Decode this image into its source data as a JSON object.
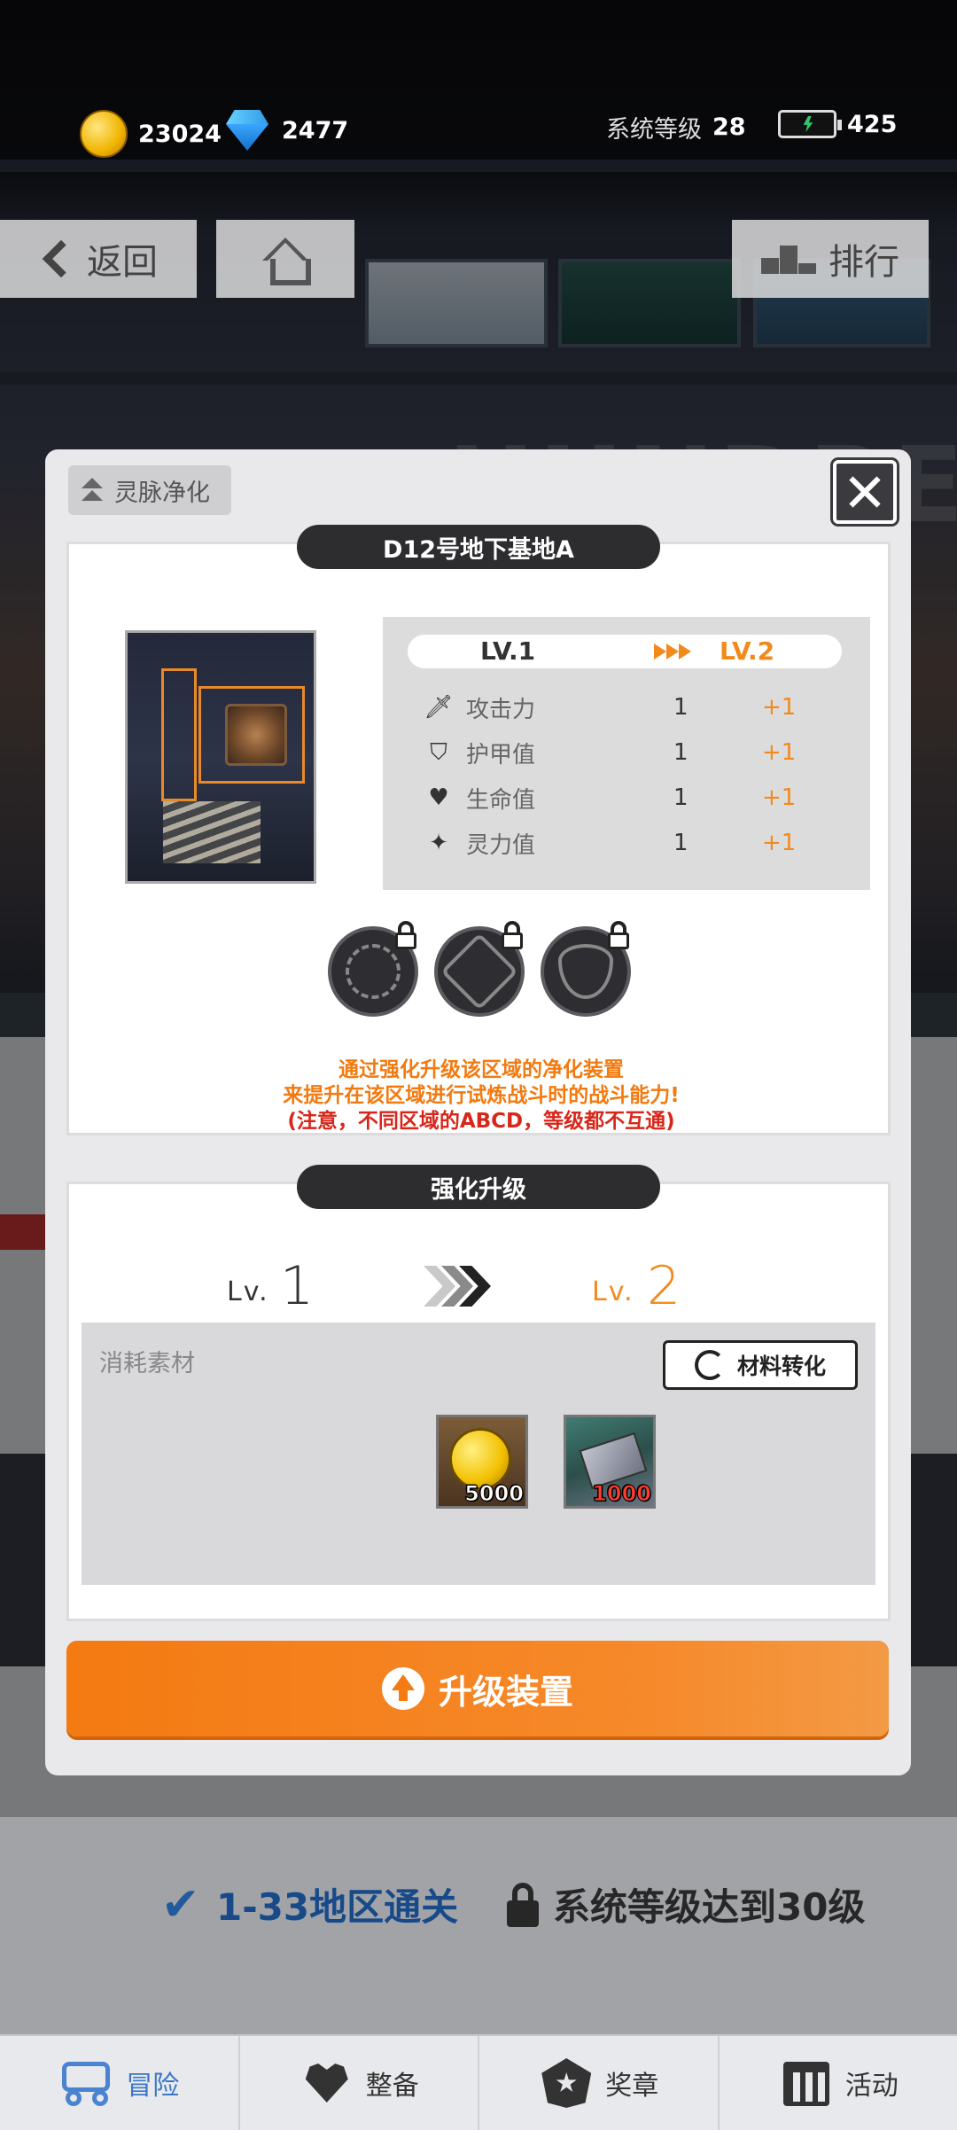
{
  "topbar": {
    "coins": "23024",
    "gems": "2477",
    "system_level_label": "系统等级",
    "system_level": "28",
    "energy": "425",
    "icons": {
      "coins": "gold-coin-icon",
      "gems": "diamond-icon",
      "energy": "battery-icon"
    }
  },
  "nav_buttons": {
    "back": "返回",
    "home": "home-icon",
    "rank": "排行"
  },
  "scene": {
    "watermark": "HUNDRED"
  },
  "modal": {
    "tag": "灵脉净化",
    "area_title": "D12号地下基地A",
    "level_from": "LV.1",
    "level_to": "LV.2",
    "stats": [
      {
        "icon": "attack-icon",
        "name": "攻击力",
        "value": "1",
        "bonus": "+1"
      },
      {
        "icon": "shield-icon",
        "name": "护甲值",
        "value": "1",
        "bonus": "+1"
      },
      {
        "icon": "heart-icon",
        "name": "生命值",
        "value": "1",
        "bonus": "+1"
      },
      {
        "icon": "sparkle-icon",
        "name": "灵力值",
        "value": "1",
        "bonus": "+1"
      }
    ],
    "runes": [
      "locked-rune-1",
      "locked-rune-2",
      "locked-rune-3"
    ],
    "notice": [
      "通过强化升级该区域的净化装置",
      "来提升在该区域进行试炼战斗时的战斗能力!",
      "(注意，不同区域的ABCD，等级都不互通)"
    ],
    "upgrade_section": {
      "title": "强化升级",
      "lv_prefix": "Lv.",
      "current_level": "1",
      "next_level": "2",
      "materials_label": "消耗素材",
      "convert_button": "材料转化",
      "materials": [
        {
          "icon": "gold-coin-icon",
          "qty": "5000"
        },
        {
          "icon": "crystal-material-icon",
          "qty": "1000"
        }
      ]
    },
    "upgrade_button": "升级装置"
  },
  "requirements": {
    "cleared": "1-33地区通关",
    "locked": "系统等级达到30级"
  },
  "bottom_nav": [
    {
      "label": "冒险",
      "icon": "truck-icon",
      "active": true
    },
    {
      "label": "整备",
      "icon": "heart-icon",
      "active": false
    },
    {
      "label": "奖章",
      "icon": "medal-icon",
      "active": false
    },
    {
      "label": "活动",
      "icon": "calendar-icon",
      "active": false
    }
  ],
  "colors": {
    "accent": "#f47a12",
    "nav_active": "#3a76c8",
    "notice_red": "#d8261a"
  }
}
